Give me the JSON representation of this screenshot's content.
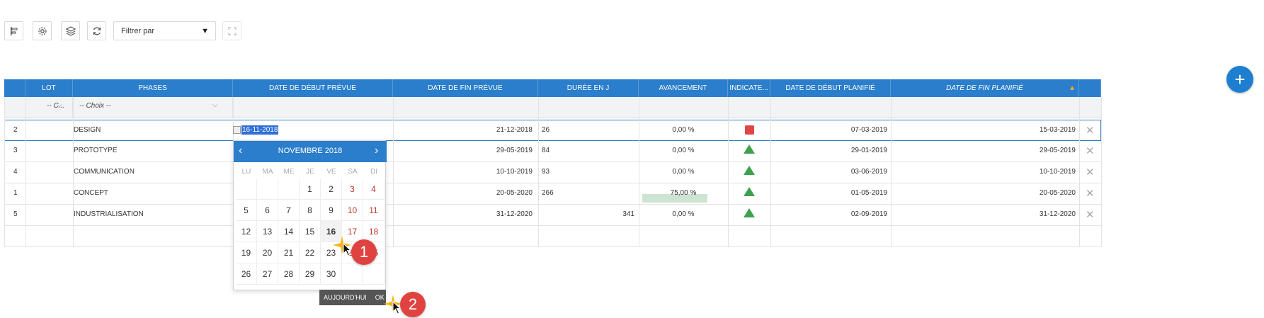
{
  "toolbar": {
    "buttons": [
      {
        "icon": "align-left-icon"
      },
      {
        "icon": "gear-icon"
      },
      {
        "icon": "layers-icon"
      },
      {
        "icon": "refresh-icon"
      }
    ],
    "filter_value": "Filtrer par",
    "filter_arrow": "▼",
    "fullscreen_icon": "fullscreen-icon"
  },
  "fab": {
    "label": "+"
  },
  "columns": {
    "lot": "LOT",
    "phases": "PHASES",
    "start_planned": "DATE DE DÉBUT PRÉVUE",
    "end_planned": "DATE DE FIN PRÉVUE",
    "duration": "DURÉE EN J",
    "progress": "AVANCEMENT",
    "indicator": "INDICATE...",
    "start_scheduled": "DATE DE DÉBUT PLANIFIÉ",
    "end_scheduled": "DATE DE FIN PLANIFIÉ",
    "sort_mark": "▲"
  },
  "filters": {
    "lot": "-- C...",
    "phases": "-- Choix --",
    "chevron": "⌵"
  },
  "rows": [
    {
      "num": "2",
      "phase": "DESIGN",
      "start": "16-11-2018",
      "end": "21-12-2018",
      "duration": "26",
      "progress": "0,00 %",
      "indicator": "red",
      "sched_start": "07-03-2019",
      "sched_end": "15-03-2019"
    },
    {
      "num": "3",
      "phase": "PROTOTYPE",
      "start": "",
      "end": "29-05-2019",
      "duration": "84",
      "progress": "0,00 %",
      "indicator": "green",
      "sched_start": "29-01-2019",
      "sched_end": "29-05-2019"
    },
    {
      "num": "4",
      "phase": "COMMUNICATION",
      "start": "",
      "end": "10-10-2019",
      "duration": "93",
      "progress": "0,00 %",
      "indicator": "green",
      "sched_start": "03-06-2019",
      "sched_end": "10-10-2019"
    },
    {
      "num": "1",
      "phase": "CONCEPT",
      "start": "",
      "end": "20-05-2020",
      "duration": "266",
      "progress": "75,00 %",
      "progress_fraction": 0.75,
      "indicator": "green",
      "sched_start": "01-05-2019",
      "sched_end": "20-05-2020"
    },
    {
      "num": "5",
      "phase": "INDUSTRIALISATION",
      "start": "",
      "end": "31-12-2020",
      "duration": "341",
      "progress": "0,00 %",
      "indicator": "green",
      "sched_start": "02-09-2019",
      "sched_end": "31-12-2020"
    }
  ],
  "delete_glyph": "✕",
  "datepicker": {
    "month": "NOVEMBRE 2018",
    "prev": "‹",
    "next": "›",
    "dow": [
      "LU",
      "MA",
      "ME",
      "JE",
      "VE",
      "SA",
      "DI"
    ],
    "weeks": [
      [
        "",
        "",
        "",
        "1",
        "2",
        "3",
        "4"
      ],
      [
        "5",
        "6",
        "7",
        "8",
        "9",
        "10",
        "11"
      ],
      [
        "12",
        "13",
        "14",
        "15",
        "16",
        "17",
        "18"
      ],
      [
        "19",
        "20",
        "21",
        "22",
        "23",
        "24",
        "25"
      ],
      [
        "26",
        "27",
        "28",
        "29",
        "30",
        "",
        ""
      ]
    ],
    "selected_day": "16",
    "today_label": "AUJOURD'HUI",
    "ok_label": "OK"
  },
  "annotations": [
    "1",
    "2"
  ],
  "colors": {
    "header": "#2b7ecb",
    "weekend": "#c0392b",
    "indicator_red": "#e04646",
    "indicator_green": "#3fa150",
    "badge": "#e0433f"
  }
}
